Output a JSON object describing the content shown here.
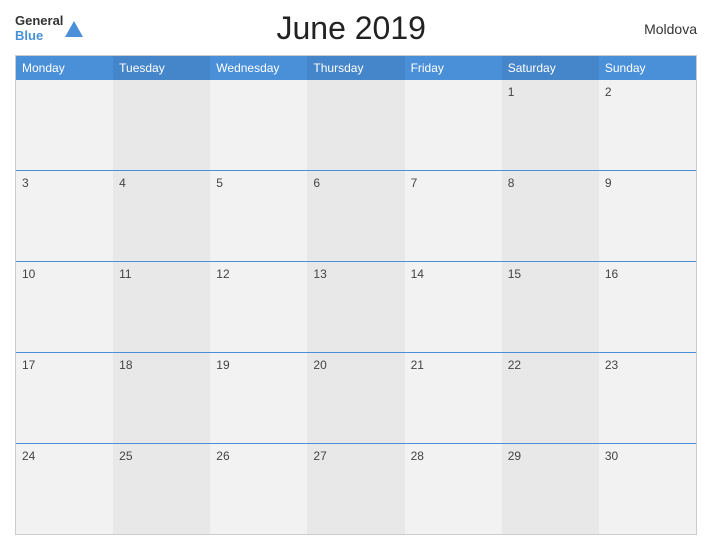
{
  "header": {
    "title": "June 2019",
    "country": "Moldova",
    "logo_general": "General",
    "logo_blue": "Blue"
  },
  "days": {
    "headers": [
      "Monday",
      "Tuesday",
      "Wednesday",
      "Thursday",
      "Friday",
      "Saturday",
      "Sunday"
    ]
  },
  "weeks": [
    [
      {
        "date": "",
        "empty": true
      },
      {
        "date": "",
        "empty": true
      },
      {
        "date": "",
        "empty": true
      },
      {
        "date": "",
        "empty": true
      },
      {
        "date": "",
        "empty": true
      },
      {
        "date": "1",
        "empty": false
      },
      {
        "date": "2",
        "empty": false
      }
    ],
    [
      {
        "date": "3",
        "empty": false
      },
      {
        "date": "4",
        "empty": false
      },
      {
        "date": "5",
        "empty": false
      },
      {
        "date": "6",
        "empty": false
      },
      {
        "date": "7",
        "empty": false
      },
      {
        "date": "8",
        "empty": false
      },
      {
        "date": "9",
        "empty": false
      }
    ],
    [
      {
        "date": "10",
        "empty": false
      },
      {
        "date": "11",
        "empty": false
      },
      {
        "date": "12",
        "empty": false
      },
      {
        "date": "13",
        "empty": false
      },
      {
        "date": "14",
        "empty": false
      },
      {
        "date": "15",
        "empty": false
      },
      {
        "date": "16",
        "empty": false
      }
    ],
    [
      {
        "date": "17",
        "empty": false
      },
      {
        "date": "18",
        "empty": false
      },
      {
        "date": "19",
        "empty": false
      },
      {
        "date": "20",
        "empty": false
      },
      {
        "date": "21",
        "empty": false
      },
      {
        "date": "22",
        "empty": false
      },
      {
        "date": "23",
        "empty": false
      }
    ],
    [
      {
        "date": "24",
        "empty": false
      },
      {
        "date": "25",
        "empty": false
      },
      {
        "date": "26",
        "empty": false
      },
      {
        "date": "27",
        "empty": false
      },
      {
        "date": "28",
        "empty": false
      },
      {
        "date": "29",
        "empty": false
      },
      {
        "date": "30",
        "empty": false
      }
    ]
  ]
}
